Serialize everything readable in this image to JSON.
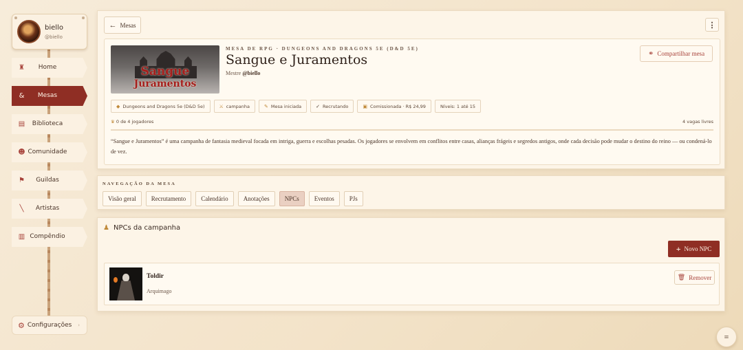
{
  "user": {
    "name": "biello",
    "handle": "@biello"
  },
  "sidebar": {
    "items": [
      {
        "label": "Home",
        "icon": "castle-icon"
      },
      {
        "label": "Mesas",
        "icon": "mask-icon",
        "active": true
      },
      {
        "label": "Biblioteca",
        "icon": "book-icon"
      },
      {
        "label": "Comunidade",
        "icon": "people-icon"
      },
      {
        "label": "Guildas",
        "icon": "flag-icon"
      },
      {
        "label": "Artistas",
        "icon": "brush-icon"
      },
      {
        "label": "Compêndio",
        "icon": "open-book-icon"
      }
    ],
    "settings_label": "Configurações"
  },
  "header": {
    "back_label": "Mesas"
  },
  "table": {
    "kicker": "MESA DE RPG · DUNGEONS AND DRAGONS 5E (D&D 5E)",
    "title": "Sangue e Juramentos",
    "master_prefix": "Mestre",
    "master_name": "@biello",
    "share_label": "Compartilhar mesa",
    "cover_line1": "Sangue",
    "cover_line2": "Juramentos",
    "tags": [
      "Dungeons and Dragons 5e (D&D 5e)",
      "campanha",
      "Mesa iniciada",
      "Recrutando",
      "Comissionada · R$ 24,99",
      "Níveis: 1 até 15"
    ],
    "players_text": "0 de 4 jogadores",
    "players_filled": 0,
    "players_total": 4,
    "vacancies_text": "4 vagas livres",
    "description": "“Sangue e Juramentos” é uma campanha de fantasia medieval focada em intriga, guerra e escolhas pesadas. Os jogadores se envolvem em conflitos entre casas, alianças frágeis e segredos antigos, onde cada decisão pode mudar o destino do reino — ou condená-lo de vez."
  },
  "navigation": {
    "label": "NAVEGAÇÃO DA MESA",
    "tabs": [
      "Visão geral",
      "Recrutamento",
      "Calendário",
      "Anotações",
      "NPCs",
      "Eventos",
      "PJs"
    ],
    "active_tab": "NPCs"
  },
  "npcs": {
    "title": "NPCs da campanha",
    "new_label": "Novo NPC",
    "items": [
      {
        "name": "Toldir",
        "role": "Arquimago",
        "remove_label": "Remover"
      }
    ]
  },
  "colors": {
    "accent": "#8f2e24",
    "background": "#f5e8d3",
    "panel": "#fdf5e8"
  }
}
